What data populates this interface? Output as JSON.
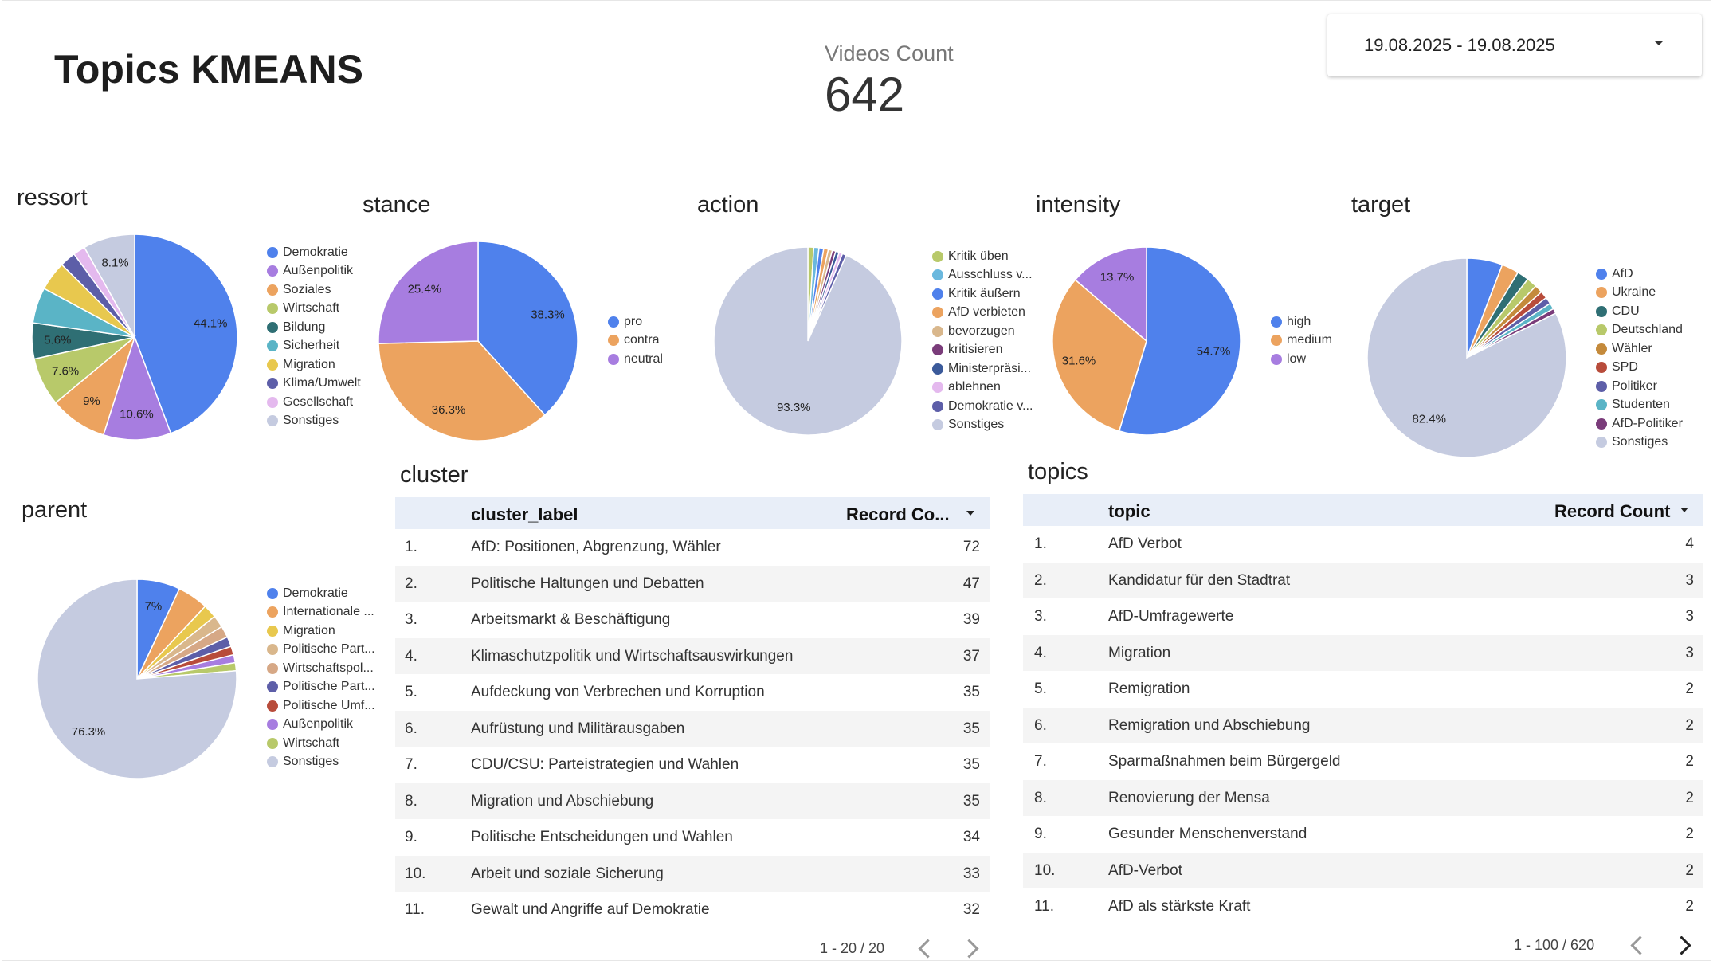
{
  "header": {
    "title": "Topics KMEANS",
    "scorecard": {
      "label": "Videos Count",
      "value": "642"
    },
    "date_range": "19.08.2025 - 19.08.2025"
  },
  "charts": {
    "ressort": {
      "title": "ressort",
      "slices": [
        {
          "label": "Demokratie",
          "value": 44.1,
          "color": "#4f81ec",
          "shown": "44.1%"
        },
        {
          "label": "Außenpolitik",
          "value": 10.6,
          "color": "#a77de0",
          "shown": "10.6%"
        },
        {
          "label": "Soziales",
          "value": 9.0,
          "color": "#eca35f",
          "shown": "9%"
        },
        {
          "label": "Wirtschaft",
          "value": 7.6,
          "color": "#b8c96a",
          "shown": "7.6%"
        },
        {
          "label": "Bildung",
          "value": 5.6,
          "color": "#2f6f74",
          "shown": "5.6%"
        },
        {
          "label": "Sicherheit",
          "value": 5.6,
          "color": "#5ab4c6",
          "shown": ""
        },
        {
          "label": "Migration",
          "value": 4.6,
          "color": "#e8c84e",
          "shown": ""
        },
        {
          "label": "Klima/Umwelt",
          "value": 2.5,
          "color": "#5d5ea8",
          "shown": ""
        },
        {
          "label": "Gesellschaft",
          "value": 1.9,
          "color": "#e4b9ee",
          "shown": ""
        },
        {
          "label": "Sonstiges",
          "value": 8.1,
          "color": "#c5cbe0",
          "shown": "8.1%"
        }
      ]
    },
    "stance": {
      "title": "stance",
      "slices": [
        {
          "label": "pro",
          "value": 38.3,
          "color": "#4f81ec",
          "shown": "38.3%"
        },
        {
          "label": "contra",
          "value": 36.3,
          "color": "#eca35f",
          "shown": "36.3%"
        },
        {
          "label": "neutral",
          "value": 25.4,
          "color": "#a77de0",
          "shown": "25.4%"
        }
      ]
    },
    "action": {
      "title": "action",
      "slices": [
        {
          "label": "Kritik üben",
          "value": 1.0,
          "color": "#b8c96a",
          "shown": ""
        },
        {
          "label": "Ausschluss v...",
          "value": 0.9,
          "color": "#6ab8de",
          "shown": ""
        },
        {
          "label": "Kritik äußern",
          "value": 0.8,
          "color": "#4f81ec",
          "shown": ""
        },
        {
          "label": "AfD verbieten",
          "value": 0.8,
          "color": "#eca35f",
          "shown": ""
        },
        {
          "label": "bevorzugen",
          "value": 0.7,
          "color": "#d9b78c",
          "shown": ""
        },
        {
          "label": "kritisieren",
          "value": 0.6,
          "color": "#7a3c7a",
          "shown": ""
        },
        {
          "label": "Ministerpräsi...",
          "value": 0.6,
          "color": "#3b5a9a",
          "shown": ""
        },
        {
          "label": "ablehnen",
          "value": 0.6,
          "color": "#e4b9ee",
          "shown": ""
        },
        {
          "label": "Demokratie v...",
          "value": 0.7,
          "color": "#5d5ea8",
          "shown": ""
        },
        {
          "label": "Sonstiges",
          "value": 93.3,
          "color": "#c5cbe0",
          "shown": "93.3%"
        }
      ]
    },
    "intensity": {
      "title": "intensity",
      "slices": [
        {
          "label": "high",
          "value": 54.7,
          "color": "#4f81ec",
          "shown": "54.7%"
        },
        {
          "label": "medium",
          "value": 31.6,
          "color": "#eca35f",
          "shown": "31.6%"
        },
        {
          "label": "low",
          "value": 13.7,
          "color": "#a77de0",
          "shown": "13.7%"
        }
      ]
    },
    "target": {
      "title": "target",
      "slices": [
        {
          "label": "AfD",
          "value": 5.8,
          "color": "#4f81ec",
          "shown": ""
        },
        {
          "label": "Ukraine",
          "value": 2.8,
          "color": "#eca35f",
          "shown": ""
        },
        {
          "label": "CDU",
          "value": 1.9,
          "color": "#2f6f74",
          "shown": ""
        },
        {
          "label": "Deutschland",
          "value": 1.7,
          "color": "#b8c96a",
          "shown": ""
        },
        {
          "label": "Wähler",
          "value": 1.3,
          "color": "#c48a3b",
          "shown": ""
        },
        {
          "label": "SPD",
          "value": 1.2,
          "color": "#b84c3b",
          "shown": ""
        },
        {
          "label": "Politiker",
          "value": 1.1,
          "color": "#5d5ea8",
          "shown": ""
        },
        {
          "label": "Studenten",
          "value": 1.0,
          "color": "#5ab4c6",
          "shown": ""
        },
        {
          "label": "AfD-Politiker",
          "value": 0.8,
          "color": "#7a3c7a",
          "shown": ""
        },
        {
          "label": "Sonstiges",
          "value": 82.4,
          "color": "#c5cbe0",
          "shown": "82.4%"
        }
      ]
    },
    "parent": {
      "title": "parent",
      "slices": [
        {
          "label": "Demokratie",
          "value": 7.0,
          "color": "#4f81ec",
          "shown": "7%"
        },
        {
          "label": "Internationale ...",
          "value": 5.0,
          "color": "#eca35f",
          "shown": ""
        },
        {
          "label": "Migration",
          "value": 2.2,
          "color": "#e8c84e",
          "shown": ""
        },
        {
          "label": "Politische Part...",
          "value": 2.0,
          "color": "#d9b78c",
          "shown": ""
        },
        {
          "label": "Wirtschaftspol...",
          "value": 1.9,
          "color": "#d6a886",
          "shown": ""
        },
        {
          "label": "Politische Part...",
          "value": 1.6,
          "color": "#5d5ea8",
          "shown": ""
        },
        {
          "label": "Politische Umf...",
          "value": 1.4,
          "color": "#b84c3b",
          "shown": ""
        },
        {
          "label": "Außenpolitik",
          "value": 1.3,
          "color": "#a77de0",
          "shown": ""
        },
        {
          "label": "Wirtschaft",
          "value": 1.3,
          "color": "#b8c96a",
          "shown": ""
        },
        {
          "label": "Sonstiges",
          "value": 76.3,
          "color": "#c5cbe0",
          "shown": "76.3%"
        }
      ]
    }
  },
  "cluster": {
    "title": "cluster",
    "col1": "cluster_label",
    "col2": "Record Co...",
    "rows": [
      {
        "n": "1.",
        "label": "AfD: Positionen, Abgrenzung, Wähler",
        "count": "72"
      },
      {
        "n": "2.",
        "label": "Politische Haltungen und Debatten",
        "count": "47"
      },
      {
        "n": "3.",
        "label": "Arbeitsmarkt & Beschäftigung",
        "count": "39"
      },
      {
        "n": "4.",
        "label": "Klimaschutzpolitik und Wirtschaftsauswirkungen",
        "count": "37"
      },
      {
        "n": "5.",
        "label": "Aufdeckung von Verbrechen und Korruption",
        "count": "35"
      },
      {
        "n": "6.",
        "label": "Aufrüstung und Militärausgaben",
        "count": "35"
      },
      {
        "n": "7.",
        "label": "CDU/CSU: Parteistrategien und Wahlen",
        "count": "35"
      },
      {
        "n": "8.",
        "label": "Migration und Abschiebung",
        "count": "35"
      },
      {
        "n": "9.",
        "label": "Politische Entscheidungen und Wahlen",
        "count": "34"
      },
      {
        "n": "10.",
        "label": "Arbeit und soziale Sicherung",
        "count": "33"
      },
      {
        "n": "11.",
        "label": "Gewalt und Angriffe auf Demokratie",
        "count": "32"
      }
    ],
    "pager": "1 - 20 / 20"
  },
  "topics": {
    "title": "topics",
    "col1": "topic",
    "col2": "Record Count",
    "rows": [
      {
        "n": "1.",
        "label": "AfD Verbot",
        "count": "4"
      },
      {
        "n": "2.",
        "label": "Kandidatur für den Stadtrat",
        "count": "3"
      },
      {
        "n": "3.",
        "label": "AfD-Umfragewerte",
        "count": "3"
      },
      {
        "n": "4.",
        "label": "Migration",
        "count": "3"
      },
      {
        "n": "5.",
        "label": "Remigration",
        "count": "2"
      },
      {
        "n": "6.",
        "label": "Remigration und Abschiebung",
        "count": "2"
      },
      {
        "n": "7.",
        "label": "Sparmaßnahmen beim Bürgergeld",
        "count": "2"
      },
      {
        "n": "8.",
        "label": "Renovierung der Mensa",
        "count": "2"
      },
      {
        "n": "9.",
        "label": "Gesunder Menschenverstand",
        "count": "2"
      },
      {
        "n": "10.",
        "label": "AfD-Verbot",
        "count": "2"
      },
      {
        "n": "11.",
        "label": "AfD als stärkste Kraft",
        "count": "2"
      }
    ],
    "pager": "1 - 100 / 620"
  }
}
